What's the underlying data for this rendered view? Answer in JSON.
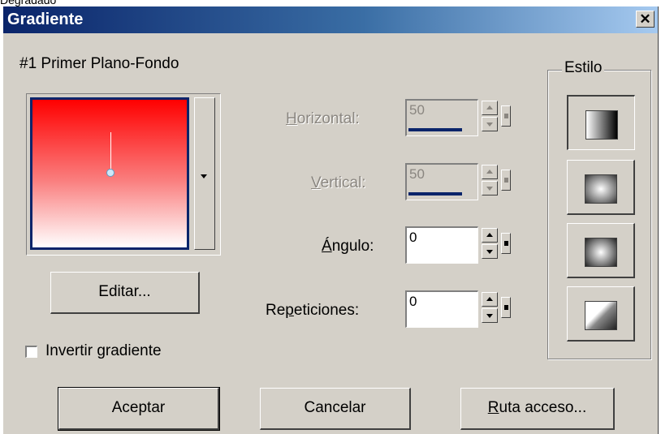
{
  "top_fragment": "Degradado",
  "window": {
    "title": "Gradiente",
    "close_glyph": "✕"
  },
  "gradient": {
    "name": "#1 Primer Plano-Fondo"
  },
  "edit_button": "Editar...",
  "invert_checkbox": {
    "label": "Invertir gradiente",
    "checked": false
  },
  "fields": {
    "horizontal": {
      "label_mn": "H",
      "label_rest": "orizontal:",
      "value": "50",
      "enabled": false
    },
    "vertical": {
      "label_mn": "V",
      "label_rest": "ertical:",
      "value": "50",
      "enabled": false
    },
    "angle": {
      "label_mn": "Á",
      "label_rest": "ngulo:",
      "value": "0",
      "enabled": true
    },
    "repeats": {
      "label_pre": "Re",
      "label_mn": "p",
      "label_rest": "eticiones:",
      "value": "0",
      "enabled": true
    }
  },
  "style_group": {
    "legend": "Estilo",
    "options": [
      {
        "name": "linear",
        "active": true
      },
      {
        "name": "rectangular",
        "active": false
      },
      {
        "name": "radial",
        "active": false
      },
      {
        "name": "sunburst",
        "active": false
      }
    ]
  },
  "buttons": {
    "ok": "Aceptar",
    "cancel": "Cancelar",
    "path_mn": "R",
    "path_rest": "uta acceso..."
  },
  "colors": {
    "title_start": "#0a246a",
    "gradient_top": "#ff0000",
    "gradient_bottom": "#ffffff"
  }
}
